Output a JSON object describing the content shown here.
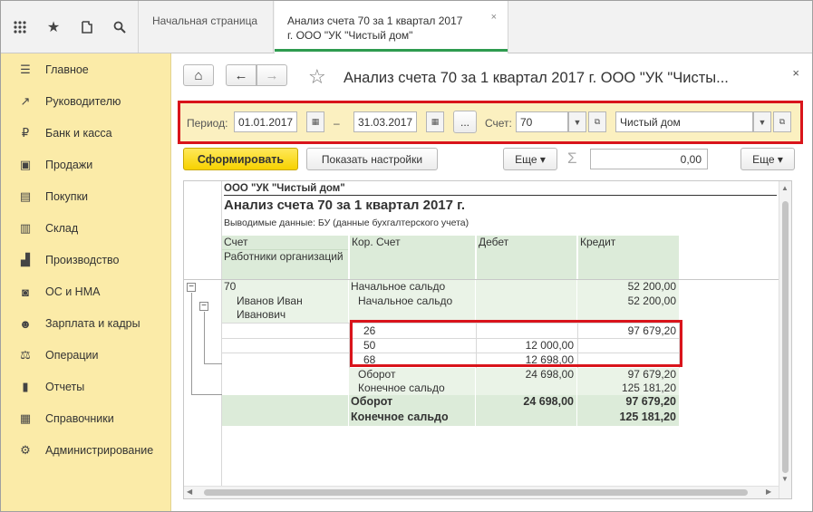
{
  "topbar": {
    "icons": [
      "grid-icon",
      "star-icon",
      "history-icon",
      "search-icon"
    ],
    "tabs": [
      {
        "label": "Начальная страница"
      },
      {
        "label_line1": "Анализ счета 70 за 1 квартал 2017",
        "label_line2": "г. ООО \"УК \"Чистый дом\"",
        "close": "×"
      }
    ]
  },
  "sidebar": {
    "items": [
      {
        "label": "Главное",
        "icon": "☰"
      },
      {
        "label": "Руководителю",
        "icon": "↗"
      },
      {
        "label": "Банк и касса",
        "icon": "₽"
      },
      {
        "label": "Продажи",
        "icon": "▣"
      },
      {
        "label": "Покупки",
        "icon": "▤"
      },
      {
        "label": "Склад",
        "icon": "▥"
      },
      {
        "label": "Производство",
        "icon": "▟"
      },
      {
        "label": "ОС и НМА",
        "icon": "◙"
      },
      {
        "label": "Зарплата и кадры",
        "icon": "☻"
      },
      {
        "label": "Операции",
        "icon": "⚖"
      },
      {
        "label": "Отчеты",
        "icon": "▮"
      },
      {
        "label": "Справочники",
        "icon": "▦"
      },
      {
        "label": "Администрирование",
        "icon": "⚙"
      }
    ]
  },
  "toolbar": {
    "home_icon": "⌂",
    "back_icon": "←",
    "forward_icon": "→",
    "star_icon": "☆",
    "title": "Анализ счета 70 за 1 квартал 2017 г. ООО \"УК \"Чисты...",
    "close": "×"
  },
  "params": {
    "period_label": "Период:",
    "date_from": "01.01.2017",
    "dash": "–",
    "date_to": "31.03.2017",
    "dots": "...",
    "account_label": "Счет:",
    "account": "70",
    "org": "Чистый дом"
  },
  "actions": {
    "generate": "Сформировать",
    "show_settings": "Показать настройки",
    "more1": "Еще ▾",
    "sigma": "Σ",
    "sum_value": "0,00",
    "more2": "Еще ▾"
  },
  "report": {
    "company": "ООО \"УК \"Чистый дом\"",
    "title": "Анализ счета 70 за 1 квартал 2017 г.",
    "output": "Выводимые данные:  БУ (данные бухгалтерского учета)",
    "headers": {
      "account": "Счет",
      "sub": "Работники организаций",
      "kor": "Кор. Счет",
      "debit": "Дебет",
      "credit": "Кредит"
    },
    "rows": {
      "acc": "70",
      "acc_open_label": "Начальное сальдо",
      "acc_open_credit": "52 200,00",
      "emp_line1": "Иванов Иван",
      "emp_line2": "Иванович",
      "emp_open_label": "Начальное сальдо",
      "emp_open_credit": "52 200,00",
      "k26": "26",
      "k26_credit": "97 679,20",
      "k50": "50",
      "k50_debit": "12 000,00",
      "k68": "68",
      "k68_debit": "12 698,00",
      "emp_turn_label": "Оборот",
      "emp_turn_debit": "24 698,00",
      "emp_turn_credit": "97 679,20",
      "emp_close_label": "Конечное сальдо",
      "emp_close_credit": "125 181,20",
      "total_turn_label": "Оборот",
      "total_turn_debit": "24 698,00",
      "total_turn_credit": "97 679,20",
      "total_close_label": "Конечное сальдо",
      "total_close_credit": "125 181,20"
    }
  }
}
